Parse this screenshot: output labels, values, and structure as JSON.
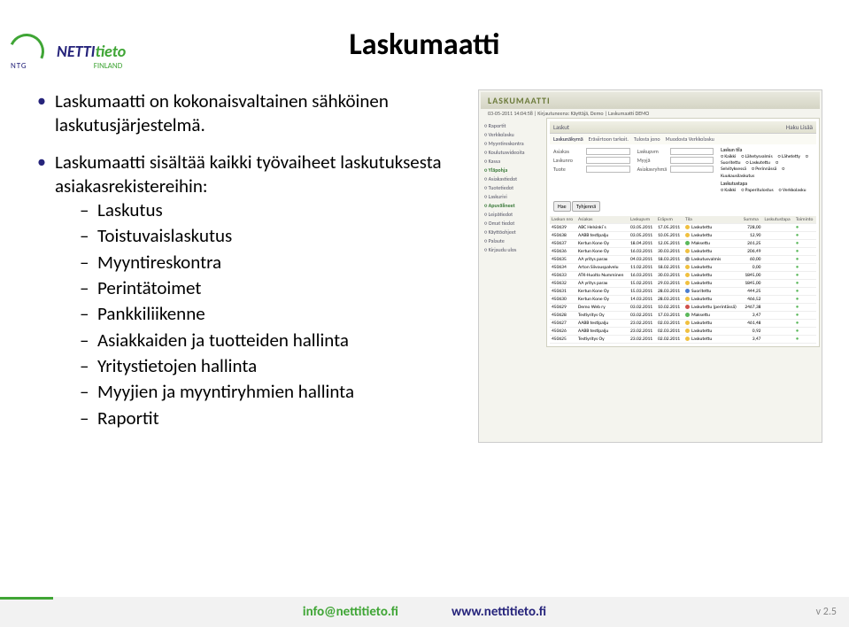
{
  "logo": {
    "line1_a": "NETTI",
    "line1_b": "tieto",
    "sub1": "NTG",
    "sub2": "FINLAND"
  },
  "title": "Laskumaatti",
  "bullets": [
    "Laskumaatti on kokonaisvaltainen sähköinen laskutusjärjestelmä.",
    "Laskumaatti sisältää kaikki työvaiheet laskutuksesta asiakasrekistereihin:"
  ],
  "subitems": [
    "Laskutus",
    "Toistuvaislaskutus",
    "Myyntireskontra",
    "Perintätoimet",
    "Pankkiliikenne",
    "Asiakkaiden ja tuotteiden hallinta",
    "Yritystietojen hallinta",
    "Myyjien ja myyntiryhmien hallinta",
    "Raportit"
  ],
  "app": {
    "brand": "LASKUMAATTI",
    "crumb": "03-05-2011 14:04:58 | Kirjautuneena: Käyttäjä, Demo | Laskumaatti DEMO",
    "side": [
      {
        "t": "Raportit",
        "h": 0
      },
      {
        "t": "Verkkolasku",
        "h": 0
      },
      {
        "t": "Myyntireskontra",
        "h": 0
      },
      {
        "t": "Koulutusvideoita",
        "h": 0
      },
      {
        "t": "Kassa",
        "h": 0
      },
      {
        "t": "Yläpohja",
        "h": 1
      },
      {
        "t": "Asiakastiedot",
        "h": 0
      },
      {
        "t": "Tuotetiedot",
        "h": 0
      },
      {
        "t": "Laskurivi",
        "h": 0
      },
      {
        "t": "Apuvälineet",
        "h": 1
      },
      {
        "t": "Leipätiedot",
        "h": 0
      },
      {
        "t": "Omat tiedot",
        "h": 0
      },
      {
        "t": "Käyttöohjeet",
        "h": 0
      },
      {
        "t": "Palaute",
        "h": 0
      },
      {
        "t": "Kirjaudu ulos",
        "h": 0
      }
    ],
    "panel": {
      "title": "Laskut",
      "haku": "Haku",
      "uusi": "Lisää",
      "tabs": [
        "Laskunäkymä",
        "Eräsiirtoon tarkoit.",
        "Tulosta jono",
        "Muodosta Verkkolasku"
      ]
    },
    "filters": {
      "c1": [
        [
          "Asiakas",
          ""
        ],
        [
          "Laskunro",
          ""
        ],
        [
          "Tuote",
          ""
        ]
      ],
      "c2": [
        [
          "Laskupvm",
          ""
        ],
        [
          "Myyjä",
          ""
        ],
        [
          "Asiakasryhmä",
          ""
        ]
      ],
      "groups": [
        {
          "title": "Laskun tila",
          "items": [
            "Kaikki",
            "Lähetysvalmis",
            "Lähetetty",
            "Suoritettu",
            "Laskutettu",
            "Selvityksessä",
            "Perinnässä",
            "Kuukausilaskutus"
          ]
        },
        {
          "title": "Laskutustapa",
          "items": [
            "Kaikki",
            "Paperitulostus",
            "Verkkolasku"
          ]
        }
      ],
      "btnHae": "Hae",
      "btnTyhj": "Tyhjennä"
    },
    "cols": [
      "Laskun nro",
      "Asiakas",
      "Laskupvm",
      "Eräpvm",
      "Tila",
      "Summa",
      "Laskutustapa",
      "Toiminto"
    ],
    "rows": [
      [
        "450639",
        "ABC Helsinki´s",
        "03.05.2011",
        "17.05.2011",
        "Laskutettu",
        "728,00",
        "",
        1
      ],
      [
        "450638",
        "AABB testipalju",
        "03.05.2011",
        "10.05.2011",
        "Laskutettu",
        "12,90",
        "",
        1
      ],
      [
        "450637",
        "Kertun Kone Oy",
        "18.04.2011",
        "12.05.2011",
        "Maksettu",
        "261,25",
        "",
        0
      ],
      [
        "450636",
        "Kertun Kone Oy",
        "16.03.2011",
        "30.03.2011",
        "Laskutettu",
        "206,49",
        "",
        1
      ],
      [
        "450635",
        "AA yritys parax",
        "04.03.2011",
        "18.03.2011",
        "Laskutusvalmis",
        "60,00",
        "",
        2
      ],
      [
        "450634",
        "Arton Siivouspalvelu",
        "11.02.2011",
        "18.02.2011",
        "Laskutettu",
        "0,00",
        "",
        1
      ],
      [
        "450633",
        "ATK-Huolto Numminen",
        "16.03.2011",
        "30.03.2011",
        "Laskutettu",
        "1845,00",
        "",
        1
      ],
      [
        "450632",
        "AA yritys parax",
        "15.02.2011",
        "29.03.2011",
        "Laskutettu",
        "1845,00",
        "",
        1
      ],
      [
        "450631",
        "Kertun Kone Oy",
        "15.03.2011",
        "28.03.2011",
        "Suoritettu",
        "444,25",
        "",
        3
      ],
      [
        "450630",
        "Kertun Kone Oy",
        "14.03.2011",
        "28.03.2011",
        "Laskutettu",
        "466,52",
        "",
        1
      ],
      [
        "450629",
        "Demo Web ry",
        "03.02.2011",
        "10.02.2011",
        "Laskutettu (perintässä)",
        "2467,38",
        "",
        4
      ],
      [
        "450628",
        "Testiyritys Oy",
        "03.02.2011",
        "17.03.2011",
        "Maksettu",
        "3,47",
        "",
        0
      ],
      [
        "450627",
        "AABB testipalju",
        "23.02.2011",
        "02.03.2011",
        "Laskutettu",
        "461,48",
        "",
        1
      ],
      [
        "450626",
        "AABB testipalju",
        "23.02.2011",
        "02.03.2011",
        "Laskutettu",
        "0,92",
        "",
        1
      ],
      [
        "450625",
        "Testiyritys Oy",
        "23.02.2011",
        "02.02.2011",
        "Laskutettu",
        "3,47",
        "",
        1
      ]
    ]
  },
  "footer": {
    "email": "info@nettitieto.fi",
    "web": "www.nettitieto.fi",
    "ver": "v 2.5"
  }
}
